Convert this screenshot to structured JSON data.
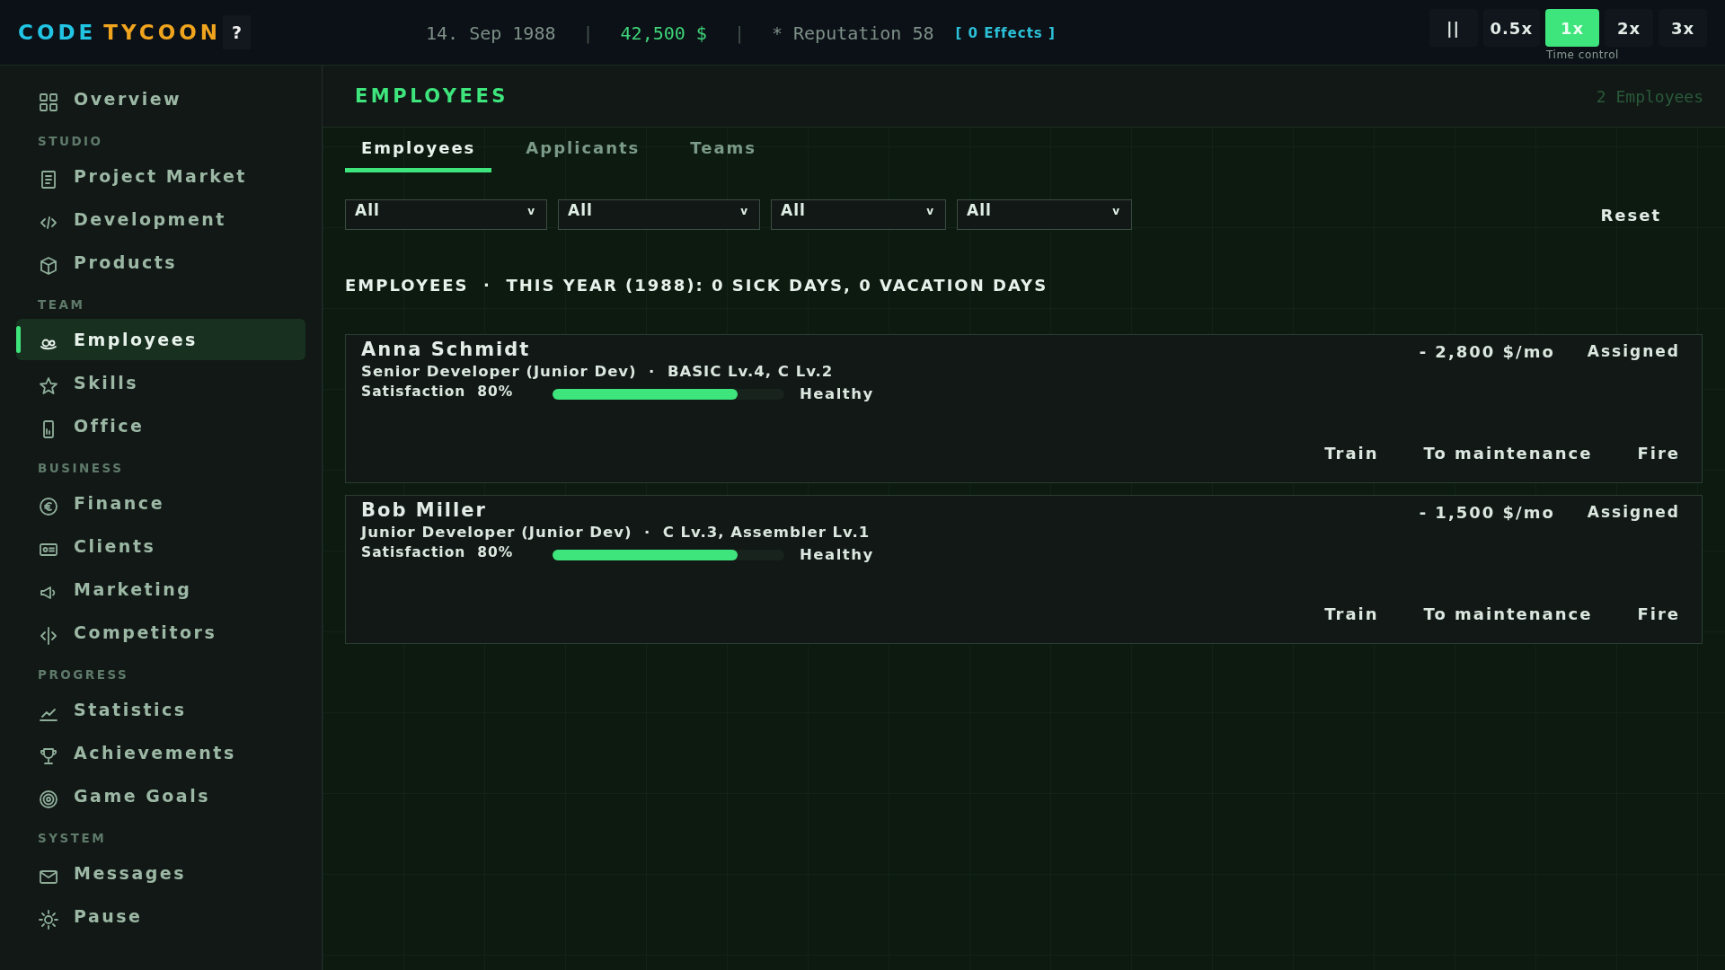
{
  "topbar": {
    "logo": [
      {
        "text": "CODE",
        "kind": "primary"
      },
      {
        "text": "TYCOON",
        "kind": "accent"
      }
    ],
    "help": "?",
    "date": "14. Sep 1988",
    "separator": "|",
    "money": "42,500 $",
    "reputation": "* Reputation 58",
    "effects": "[ 0 Effects ]",
    "speeds": [
      {
        "label": "||",
        "selected": false
      },
      {
        "label": "0.5x",
        "selected": false
      },
      {
        "label": "1x",
        "selected": true
      },
      {
        "label": "2x",
        "selected": false
      },
      {
        "label": "3x",
        "selected": false
      }
    ],
    "speed_caption": "Time control"
  },
  "sidebar": {
    "items": [
      {
        "kind": "item",
        "label": "Overview",
        "selected": false
      },
      {
        "kind": "section",
        "label": "STUDIO"
      },
      {
        "kind": "item",
        "label": "Project Market",
        "selected": false
      },
      {
        "kind": "item",
        "label": "Development",
        "selected": false
      },
      {
        "kind": "item",
        "label": "Products",
        "selected": false
      },
      {
        "kind": "section",
        "label": "TEAM"
      },
      {
        "kind": "item",
        "label": "Employees",
        "selected": true
      },
      {
        "kind": "item",
        "label": "Skills",
        "selected": false
      },
      {
        "kind": "item",
        "label": "Office",
        "selected": false
      },
      {
        "kind": "section",
        "label": "BUSINESS"
      },
      {
        "kind": "item",
        "label": "Finance",
        "selected": false
      },
      {
        "kind": "item",
        "label": "Clients",
        "selected": false
      },
      {
        "kind": "item",
        "label": "Marketing",
        "selected": false
      },
      {
        "kind": "item",
        "label": "Competitors",
        "selected": false
      },
      {
        "kind": "section",
        "label": "PROGRESS"
      },
      {
        "kind": "item",
        "label": "Statistics",
        "selected": false
      },
      {
        "kind": "item",
        "label": "Achievements",
        "selected": false
      },
      {
        "kind": "item",
        "label": "Game Goals",
        "selected": false
      },
      {
        "kind": "section",
        "label": "SYSTEM"
      },
      {
        "kind": "item",
        "label": "Messages",
        "selected": false
      },
      {
        "kind": "item",
        "label": "Pause",
        "selected": false
      }
    ]
  },
  "page": {
    "title": "EMPLOYEES",
    "count": "2 Employees",
    "tabs": [
      {
        "label": "Employees",
        "selected": true
      },
      {
        "label": "Applicants",
        "selected": false
      },
      {
        "label": "Teams",
        "selected": false
      }
    ],
    "filters": [
      {
        "value": "All",
        "caret": "v"
      },
      {
        "value": "All",
        "caret": "v"
      },
      {
        "value": "All",
        "caret": "v"
      },
      {
        "value": "All",
        "caret": "v"
      }
    ],
    "reset": "Reset",
    "summary": "EMPLOYEES  ·  THIS YEAR (1988): 0 SICK DAYS, 0 VACATION DAYS",
    "employees": [
      {
        "name": "Anna Schmidt",
        "role": "Senior Developer (Junior Dev)  ·  BASIC Lv.4, C Lv.2",
        "satisfaction": "Satisfaction  80%",
        "level": 0.8,
        "health": "Healthy",
        "salary": "- 2,800 $/mo",
        "status": "Assigned",
        "actions": [
          "Train",
          "To maintenance",
          "Fire"
        ]
      },
      {
        "name": "Bob Miller",
        "role": "Junior Developer (Junior Dev)  ·  C Lv.3, Assembler Lv.1",
        "satisfaction": "Satisfaction  80%",
        "level": 0.8,
        "health": "Healthy",
        "salary": "- 1,500 $/mo",
        "status": "Assigned",
        "actions": [
          "Train",
          "To maintenance",
          "Fire"
        ]
      }
    ]
  }
}
